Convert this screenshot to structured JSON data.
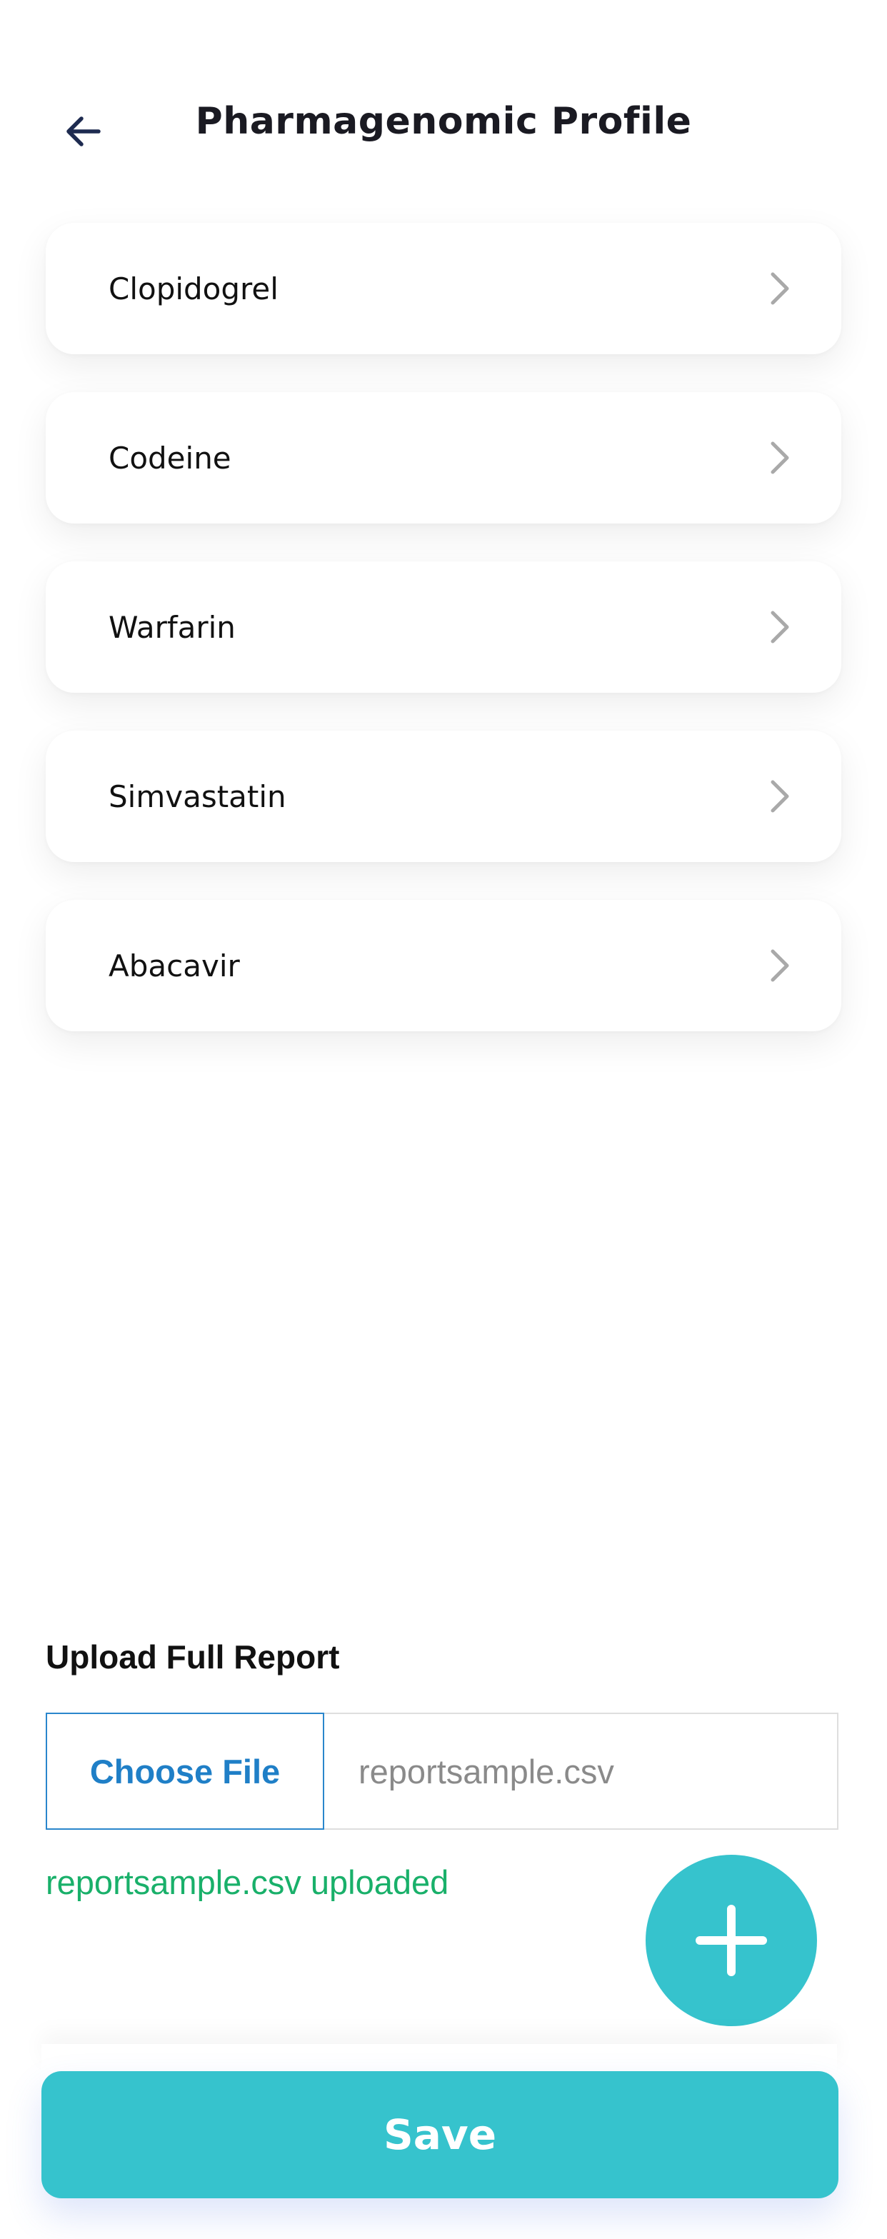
{
  "header": {
    "title": "Pharmagenomic Profile",
    "back_icon": "arrow-left-icon"
  },
  "drugs": [
    {
      "label": "Clopidogrel"
    },
    {
      "label": "Codeine"
    },
    {
      "label": "Warfarin"
    },
    {
      "label": "Simvastatin"
    },
    {
      "label": "Abacavir"
    }
  ],
  "upload": {
    "label": "Upload Full Report",
    "choose_button": "Choose File",
    "file_name": "reportsample.csv",
    "status": "reportsample.csv uploaded"
  },
  "fab": {
    "icon": "plus-icon"
  },
  "save_button": "Save",
  "colors": {
    "accent": "#36c3cd",
    "link_blue": "#1f7fc7",
    "success_green": "#19b06a",
    "title_dark": "#1a1a22",
    "back_arrow": "#1e2b50"
  }
}
